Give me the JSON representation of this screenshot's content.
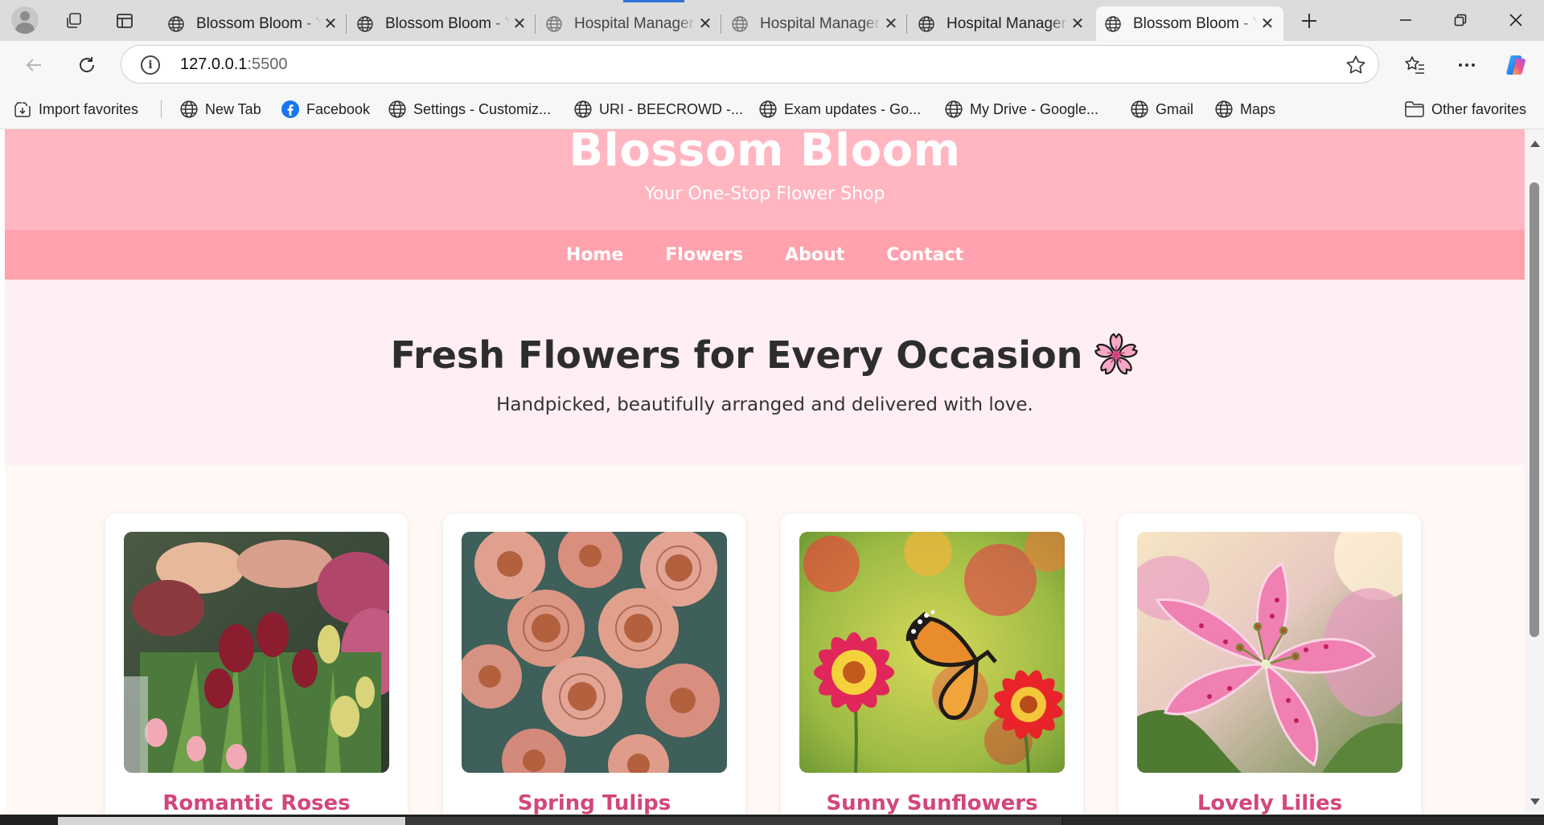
{
  "browser": {
    "tabs": [
      {
        "title": "Blossom Bloom - Y",
        "state": "normal"
      },
      {
        "title": "Blossom Bloom - Y",
        "state": "normal"
      },
      {
        "title": "Hospital Manager",
        "state": "faded"
      },
      {
        "title": "Hospital Manager",
        "state": "faded"
      },
      {
        "title": "Hospital Manager",
        "state": "normal"
      },
      {
        "title": "Blossom Bloom - Y",
        "state": "active"
      }
    ],
    "address": {
      "host": "127.0.0.1",
      "port": ":5500"
    },
    "bookmarks": {
      "import": "Import favorites",
      "items": [
        "New Tab",
        "Facebook",
        "Settings - Customiz...",
        "URI - BEECROWD -...",
        "Exam updates - Go...",
        "My Drive - Google...",
        "Gmail",
        "Maps"
      ],
      "other": "Other favorites"
    },
    "icons": {
      "profile": "profile-avatar-icon",
      "workspaces": "workspaces-icon",
      "tab_actions": "vertical-tabs-icon",
      "new_tab": "plus-icon",
      "back": "back-arrow-icon",
      "refresh": "refresh-icon",
      "info": "site-info-icon",
      "favorite": "star-icon",
      "favorites": "favorites-list-icon",
      "menu": "more-icon",
      "copilot": "copilot-icon"
    }
  },
  "site": {
    "title": "Blossom Bloom",
    "tagline": "Your One-Stop Flower Shop",
    "nav": [
      "Home",
      "Flowers",
      "About",
      "Contact"
    ],
    "hero": {
      "title": "Fresh Flowers for Every Occasion",
      "emoji": "cherry-blossom-icon",
      "text": "Handpicked, beautifully arranged and delivered with love."
    },
    "products": [
      {
        "name": "Romantic Roses",
        "image": "mixed-tulip-bouquet-photo"
      },
      {
        "name": "Spring Tulips",
        "image": "peach-garden-roses-photo"
      },
      {
        "name": "Sunny Sunflowers",
        "image": "butterfly-on-gaillardia-photo"
      },
      {
        "name": "Lovely Lilies",
        "image": "pink-stargazer-lily-photo"
      }
    ],
    "colors": {
      "header": "#ffb6c1",
      "nav": "#ffa2ad",
      "hero": "#ffeef2",
      "page": "#fff8f4",
      "product_title": "#d2477b"
    }
  }
}
